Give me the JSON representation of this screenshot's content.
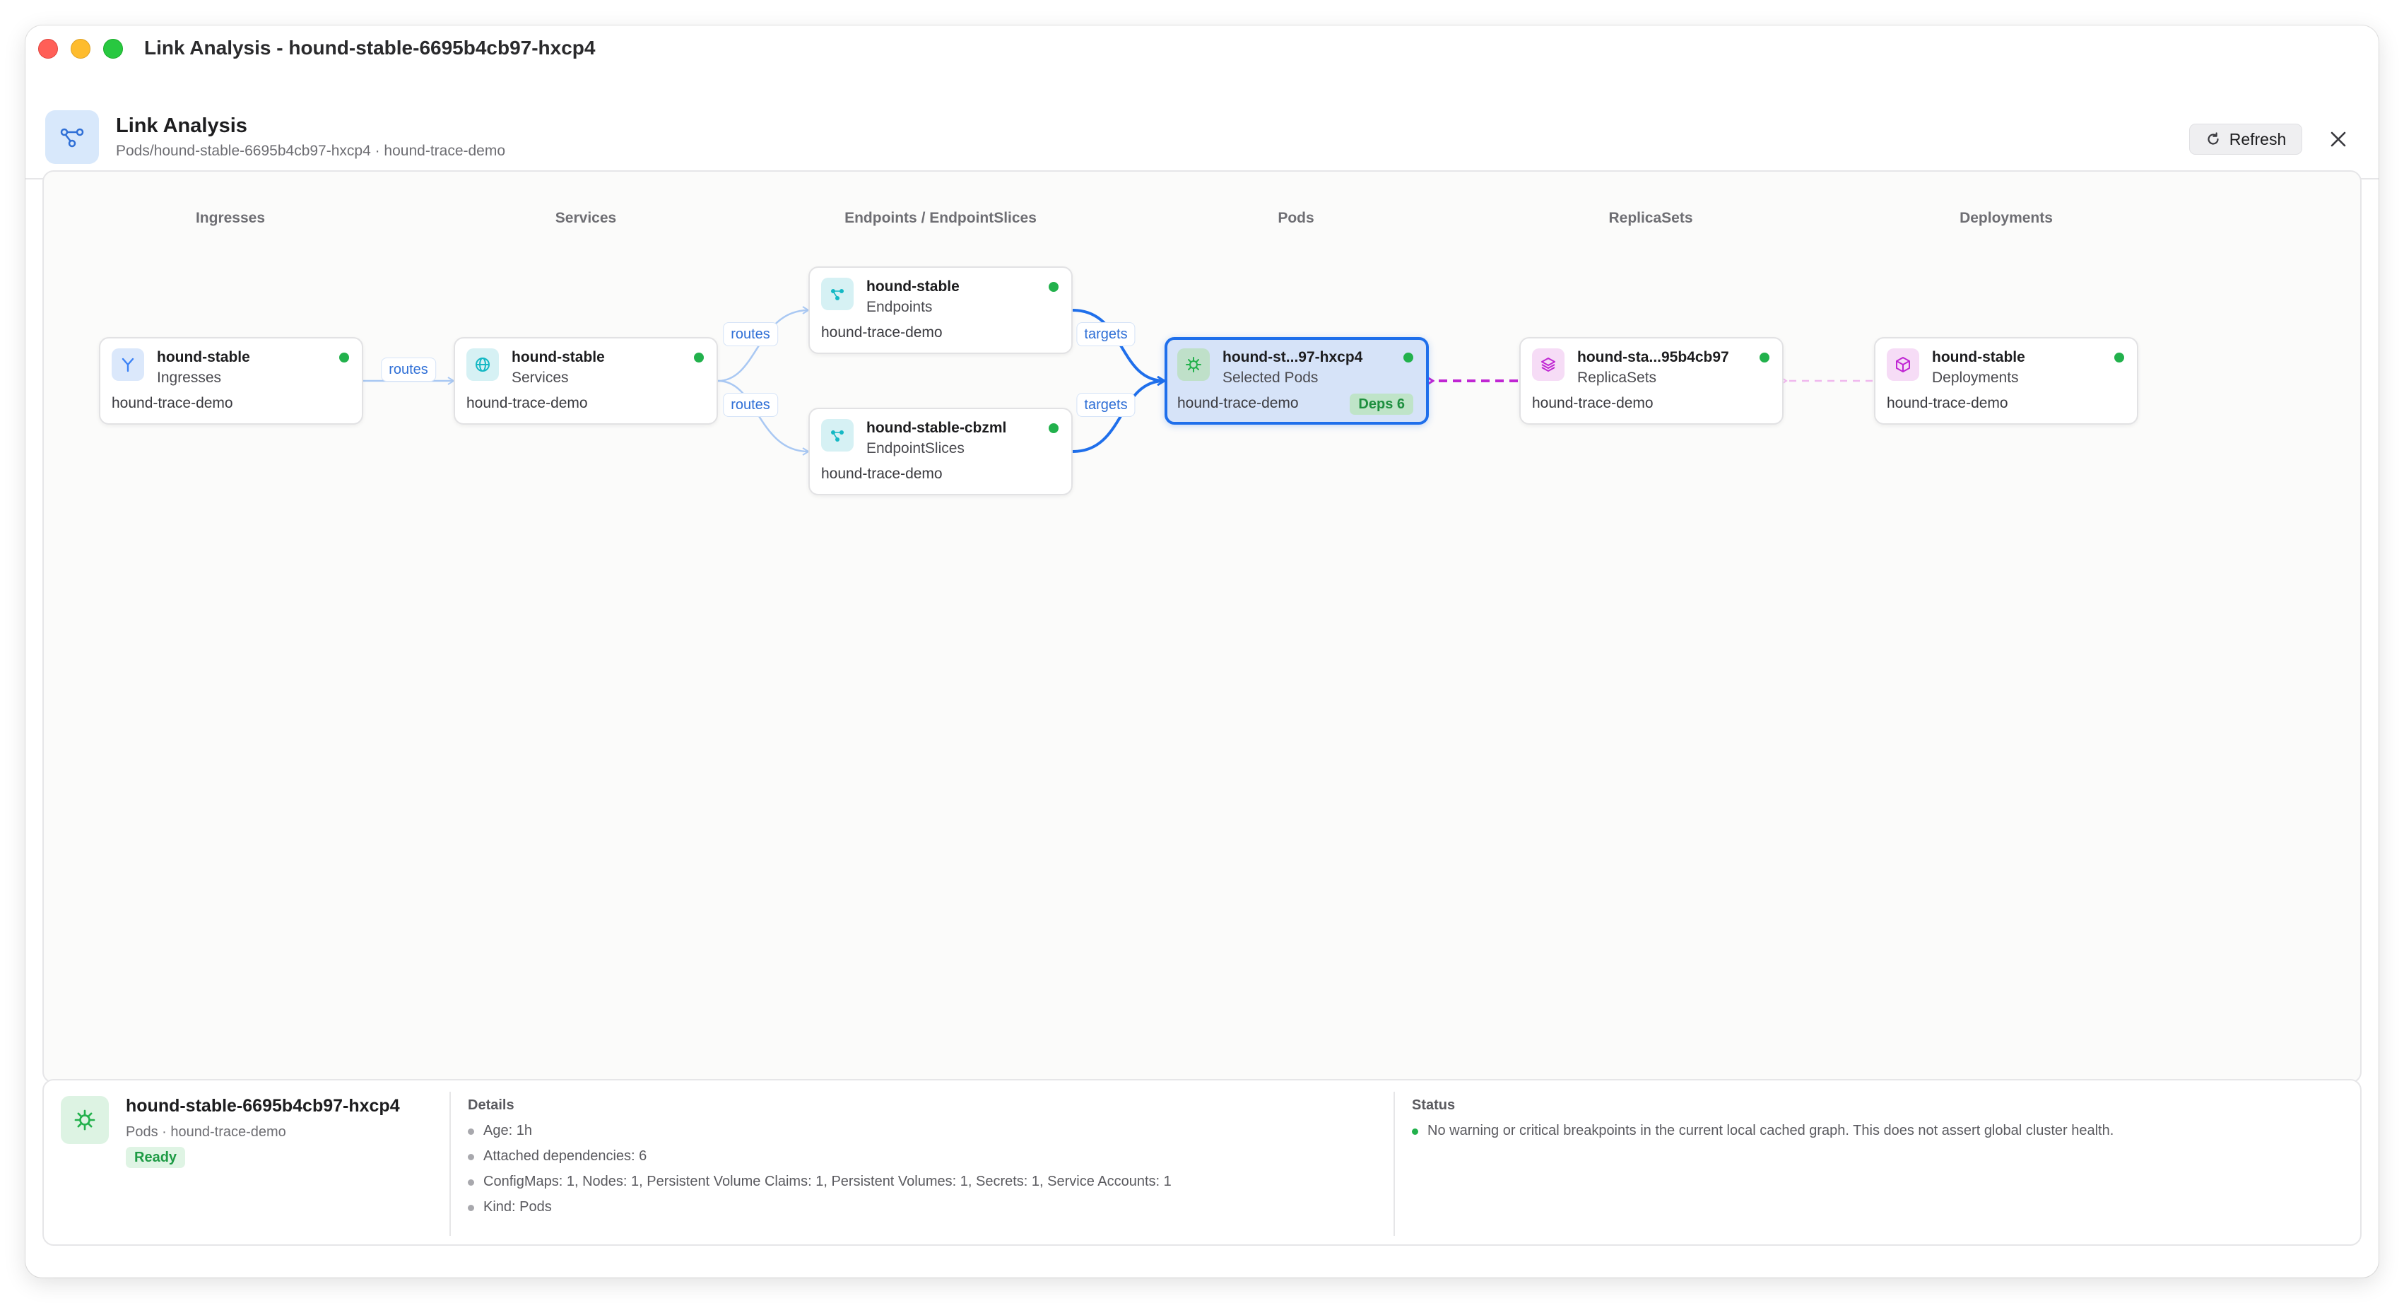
{
  "window": {
    "title": "Link Analysis - hound-stable-6695b4cb97-hxcp4"
  },
  "header": {
    "title": "Link Analysis",
    "subtitle": "Pods/hound-stable-6695b4cb97-hxcp4 · hound-trace-demo",
    "refresh_label": "Refresh"
  },
  "lanes": [
    "Ingresses",
    "Services",
    "Endpoints / EndpointSlices",
    "Pods",
    "ReplicaSets",
    "Deployments"
  ],
  "nodes": {
    "ingress": {
      "name": "hound-stable",
      "kind": "Ingresses",
      "namespace": "hound-trace-demo",
      "icon": "ingress-icon",
      "color": "#3b82f6"
    },
    "service": {
      "name": "hound-stable",
      "kind": "Services",
      "namespace": "hound-trace-demo",
      "icon": "globe-icon",
      "color": "#14b8c4"
    },
    "endpoints": {
      "name": "hound-stable",
      "kind": "Endpoints",
      "namespace": "hound-trace-demo",
      "icon": "endpoints-icon",
      "color": "#14b8c4"
    },
    "endpointslice": {
      "name": "hound-stable-cbzml",
      "kind": "EndpointSlices",
      "namespace": "hound-trace-demo",
      "icon": "endpoints-icon",
      "color": "#14b8c4"
    },
    "pod": {
      "name": "hound-st...97-hxcp4",
      "kind": "Selected Pods",
      "namespace": "hound-trace-demo",
      "badge": "Deps 6",
      "icon": "pod-icon",
      "color": "#22b14c"
    },
    "replicaset": {
      "name": "hound-sta...95b4cb97",
      "kind": "ReplicaSets",
      "namespace": "hound-trace-demo",
      "icon": "layers-icon",
      "color": "#c026d3"
    },
    "deployment": {
      "name": "hound-stable",
      "kind": "Deployments",
      "namespace": "hound-trace-demo",
      "icon": "cube-icon",
      "color": "#c026d3"
    }
  },
  "edges": {
    "ingress_service": "routes",
    "service_endpoints": "routes",
    "service_endpointslice": "routes",
    "endpoints_pod": "targets",
    "endpointslice_pod": "targets"
  },
  "details": {
    "name": "hound-stable-6695b4cb97-hxcp4",
    "sub": "Pods · hound-trace-demo",
    "ready": "Ready",
    "details_title": "Details",
    "details_items": [
      "Age: 1h",
      "Attached dependencies: 6",
      "ConfigMaps: 1, Nodes: 1, Persistent Volume Claims: 1, Persistent Volumes: 1, Secrets: 1, Service Accounts: 1",
      "Kind: Pods"
    ],
    "status_title": "Status",
    "status_items": [
      "No warning or critical breakpoints in the current local cached graph. This does not assert global cluster health."
    ]
  },
  "colors": {
    "accent": "#1f6feb",
    "ok": "#22b14c",
    "owner": "#c026d3"
  }
}
